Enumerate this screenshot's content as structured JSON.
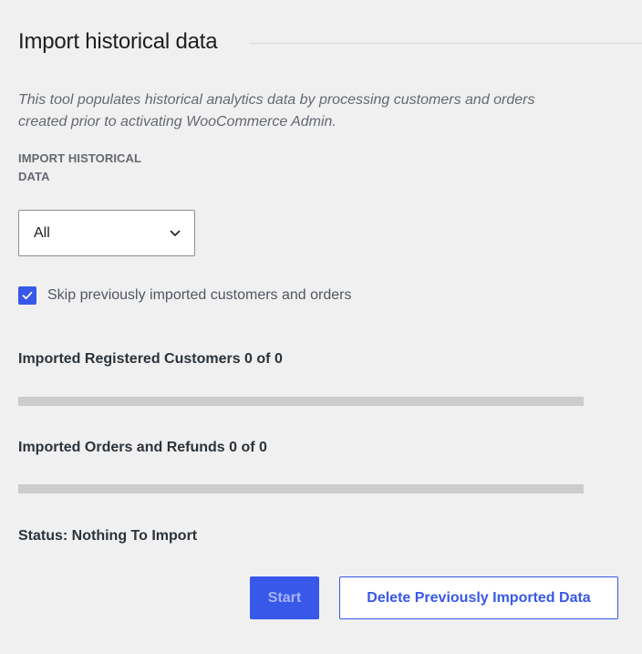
{
  "page": {
    "title": "Import historical data",
    "description": "This tool populates historical analytics data by processing customers and orders created prior to activating WooCommerce Admin."
  },
  "import_field": {
    "label": "IMPORT HISTORICAL DATA",
    "selected_value": "All",
    "icon": "chevron-down-icon"
  },
  "skip_option": {
    "checked": true,
    "label": "Skip previously imported customers and orders",
    "icon": "check-icon"
  },
  "progress": {
    "customers": {
      "label": "Imported Registered Customers 0 of 0",
      "fraction": 0
    },
    "orders": {
      "label": "Imported Orders and Refunds 0 of 0",
      "fraction": 0
    }
  },
  "status": {
    "text": "Status: Nothing To Import"
  },
  "actions": {
    "start_label": "Start",
    "delete_label": "Delete Previously Imported Data"
  },
  "colors": {
    "accent": "#3858e9",
    "track": "#cccccc",
    "background": "#f0f0f1"
  }
}
